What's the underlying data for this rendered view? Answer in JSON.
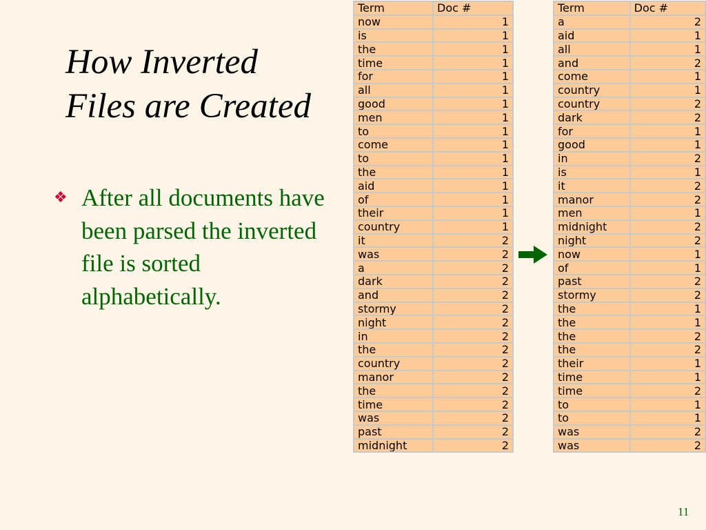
{
  "title": {
    "line1": "How Inverted",
    "line2": "Files are Created"
  },
  "bullet": {
    "text": "After all documents have been parsed the inverted file is sorted alphabetically."
  },
  "tables": {
    "header": {
      "term": "Term",
      "doc": "Doc #"
    },
    "left": [
      {
        "term": "now",
        "doc": "1"
      },
      {
        "term": "is",
        "doc": "1"
      },
      {
        "term": "the",
        "doc": "1"
      },
      {
        "term": "time",
        "doc": "1"
      },
      {
        "term": "for",
        "doc": "1"
      },
      {
        "term": "all",
        "doc": "1"
      },
      {
        "term": "good",
        "doc": "1"
      },
      {
        "term": "men",
        "doc": "1"
      },
      {
        "term": "to",
        "doc": "1"
      },
      {
        "term": "come",
        "doc": "1"
      },
      {
        "term": "to",
        "doc": "1"
      },
      {
        "term": "the",
        "doc": "1"
      },
      {
        "term": "aid",
        "doc": "1"
      },
      {
        "term": "of",
        "doc": "1"
      },
      {
        "term": "their",
        "doc": "1"
      },
      {
        "term": "country",
        "doc": "1"
      },
      {
        "term": "it",
        "doc": "2"
      },
      {
        "term": "was",
        "doc": "2"
      },
      {
        "term": "a",
        "doc": "2"
      },
      {
        "term": "dark",
        "doc": "2"
      },
      {
        "term": "and",
        "doc": "2"
      },
      {
        "term": "stormy",
        "doc": "2"
      },
      {
        "term": "night",
        "doc": "2"
      },
      {
        "term": "in",
        "doc": "2"
      },
      {
        "term": "the",
        "doc": "2"
      },
      {
        "term": "country",
        "doc": "2"
      },
      {
        "term": "manor",
        "doc": "2"
      },
      {
        "term": "the",
        "doc": "2"
      },
      {
        "term": "time",
        "doc": "2"
      },
      {
        "term": "was",
        "doc": "2"
      },
      {
        "term": "past",
        "doc": "2"
      },
      {
        "term": "midnight",
        "doc": "2"
      }
    ],
    "right": [
      {
        "term": "a",
        "doc": "2"
      },
      {
        "term": "aid",
        "doc": "1"
      },
      {
        "term": "all",
        "doc": "1"
      },
      {
        "term": "and",
        "doc": "2"
      },
      {
        "term": "come",
        "doc": "1"
      },
      {
        "term": "country",
        "doc": "1"
      },
      {
        "term": "country",
        "doc": "2"
      },
      {
        "term": "dark",
        "doc": "2"
      },
      {
        "term": "for",
        "doc": "1"
      },
      {
        "term": "good",
        "doc": "1"
      },
      {
        "term": "in",
        "doc": "2"
      },
      {
        "term": "is",
        "doc": "1"
      },
      {
        "term": "it",
        "doc": "2"
      },
      {
        "term": "manor",
        "doc": "2"
      },
      {
        "term": "men",
        "doc": "1"
      },
      {
        "term": "midnight",
        "doc": "2"
      },
      {
        "term": "night",
        "doc": "2"
      },
      {
        "term": "now",
        "doc": "1"
      },
      {
        "term": "of",
        "doc": "1"
      },
      {
        "term": "past",
        "doc": "2"
      },
      {
        "term": "stormy",
        "doc": "2"
      },
      {
        "term": "the",
        "doc": "1"
      },
      {
        "term": "the",
        "doc": "1"
      },
      {
        "term": "the",
        "doc": "2"
      },
      {
        "term": "the",
        "doc": "2"
      },
      {
        "term": "their",
        "doc": "1"
      },
      {
        "term": "time",
        "doc": "1"
      },
      {
        "term": "time",
        "doc": "2"
      },
      {
        "term": "to",
        "doc": "1"
      },
      {
        "term": "to",
        "doc": "1"
      },
      {
        "term": "was",
        "doc": "2"
      },
      {
        "term": "was",
        "doc": "2"
      }
    ]
  },
  "arrow": {
    "icon": "right-arrow-icon",
    "color": "#006400"
  },
  "page_number": "11",
  "colors": {
    "background": "#fdf5e8",
    "title": "#000000",
    "bullet_text": "#006400",
    "bullet_mark": "#cc0033",
    "cell": "#ffcc99",
    "cell_border": "#c8c8c8"
  }
}
